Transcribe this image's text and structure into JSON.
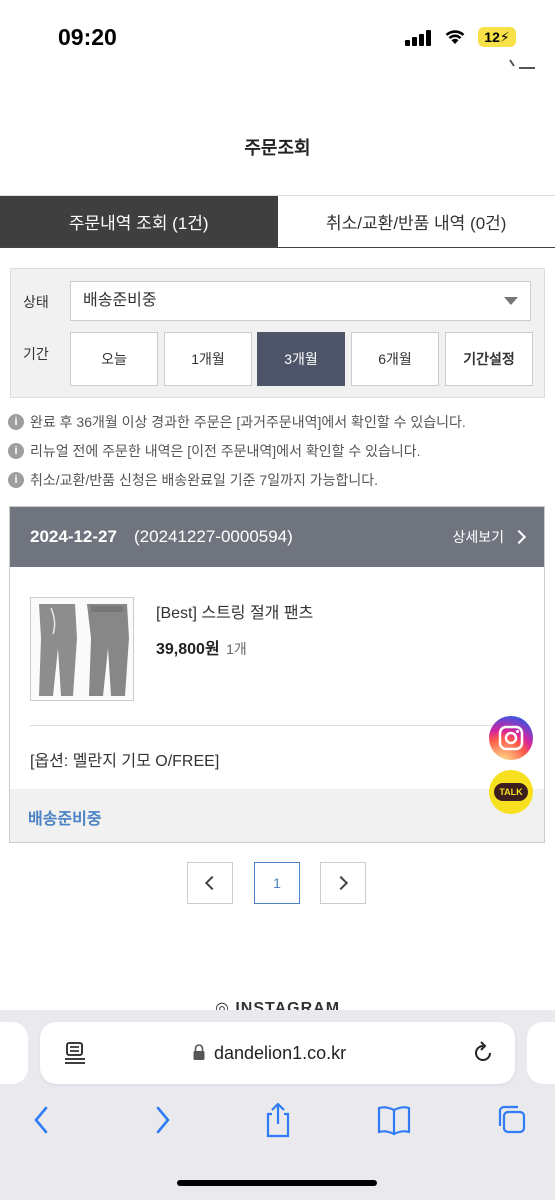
{
  "status_bar": {
    "time": "09:20",
    "battery": "12"
  },
  "page": {
    "title": "주문조회"
  },
  "tabs": [
    {
      "label": "주문내역 조회 (1건)"
    },
    {
      "label": "취소/교환/반품 내역 (0건)"
    }
  ],
  "filter": {
    "status_label": "상태",
    "status_value": "배송준비중",
    "period_label": "기간",
    "period_options": [
      "오늘",
      "1개월",
      "3개월",
      "6개월",
      "기간설정"
    ],
    "period_selected": "3개월"
  },
  "notices": [
    "완료 후 36개월 이상 경과한 주문은 [과거주문내역]에서 확인할 수 있습니다.",
    "리뉴얼 전에 주문한 내역은 [이전 주문내역]에서 확인할 수 있습니다.",
    "취소/교환/반품 신청은 배송완료일 기준 7일까지 가능합니다."
  ],
  "order": {
    "date": "2024-12-27",
    "number": "(20241227-0000594)",
    "detail_label": "상세보기",
    "product_name": "[Best] 스트링 절개 팬츠",
    "price": "39,800원",
    "quantity": "1개",
    "option": "[옵션: 멜란지 기모 O/FREE]",
    "status": "배송준비중"
  },
  "floating": {
    "talk_label": "TALK"
  },
  "pagination": {
    "current": "1"
  },
  "footer": {
    "instagram_label": "INSTAGRAM"
  },
  "browser": {
    "url": "dandelion1.co.kr"
  },
  "colors": {
    "active_tab": "#3f3f3f",
    "period_selected": "#4e5568",
    "order_header": "#6f747e",
    "status_blue": "#4a82c4",
    "talk_yellow": "#f7e01f"
  }
}
